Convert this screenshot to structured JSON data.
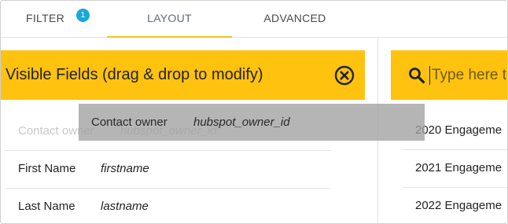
{
  "tabs": {
    "filter": {
      "label": "FILTER",
      "badge": "1"
    },
    "layout": {
      "label": "LAYOUT"
    },
    "advanced": {
      "label": "ADVANCED"
    }
  },
  "visible_fields": {
    "title": "Visible Fields (drag & drop to modify)",
    "rows": [
      {
        "label": "Contact owner",
        "api": "hubspot_owner_id"
      },
      {
        "label": "First Name",
        "api": "firstname"
      },
      {
        "label": "Last Name",
        "api": "lastname"
      }
    ],
    "dragging": {
      "label": "Contact owner",
      "api": "hubspot_owner_id"
    }
  },
  "search": {
    "placeholder": "Type here to"
  },
  "available_fields": [
    "2020 Engageme",
    "2021 Engageme",
    "2022 Engageme"
  ],
  "colors": {
    "accent": "#ffc20e",
    "badge": "#19a9d8",
    "tab_underline": "#f3c21b"
  }
}
